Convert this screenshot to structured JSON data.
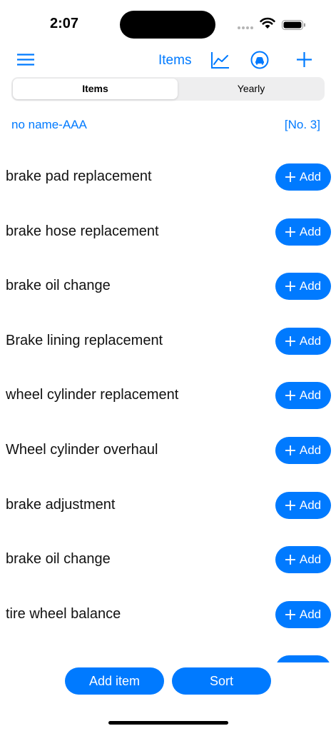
{
  "status": {
    "time": "2:07"
  },
  "nav": {
    "title": "Items"
  },
  "segments": [
    {
      "label": "Items"
    },
    {
      "label": "Yearly"
    }
  ],
  "vehicle": {
    "name": "no name-AAA",
    "number": "[No. 3]"
  },
  "add_label": "Add",
  "items": [
    {
      "label": "brake pad replacement"
    },
    {
      "label": "brake hose replacement"
    },
    {
      "label": "brake oil change"
    },
    {
      "label": "Brake lining replacement"
    },
    {
      "label": "wheel cylinder replacement"
    },
    {
      "label": "Wheel cylinder overhaul"
    },
    {
      "label": "brake adjustment"
    },
    {
      "label": "brake oil change"
    },
    {
      "label": "tire wheel balance"
    },
    {
      "label": ""
    }
  ],
  "bottom": {
    "add_item_label": "Add item",
    "sort_label": "Sort"
  },
  "colors": {
    "accent": "#007aff"
  }
}
